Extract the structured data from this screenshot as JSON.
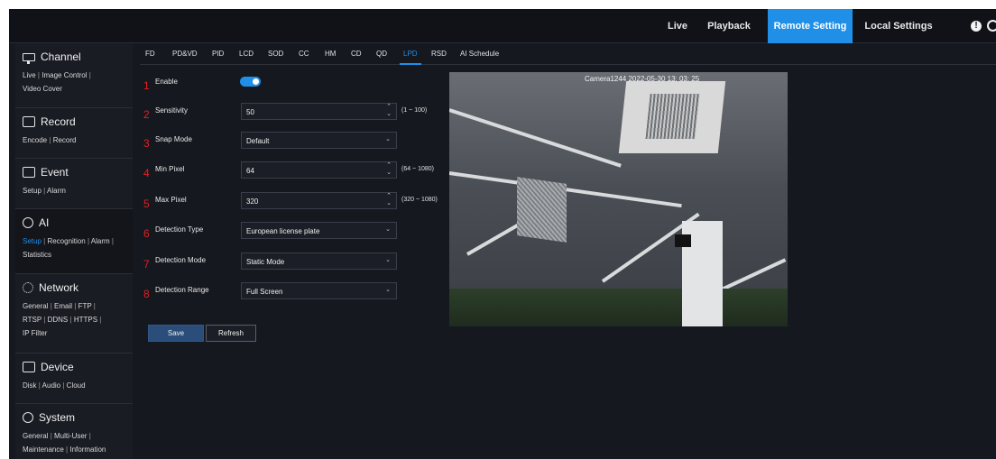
{
  "topnav": {
    "live": "Live",
    "playback": "Playback",
    "remote_setting": "Remote Setting",
    "local_settings": "Local Settings"
  },
  "sidebar": {
    "channel": {
      "title": "Channel",
      "links": [
        "Live",
        "Image Control",
        "Video Cover"
      ]
    },
    "record": {
      "title": "Record",
      "links": [
        "Encode",
        "Record"
      ]
    },
    "event": {
      "title": "Event",
      "links": [
        "Setup",
        "Alarm"
      ]
    },
    "ai": {
      "title": "AI",
      "links": [
        "Setup",
        "Recognition",
        "Alarm",
        "Statistics"
      ]
    },
    "network": {
      "title": "Network",
      "links": [
        "General",
        "Email",
        "FTP",
        "RTSP",
        "DDNS",
        "HTTPS",
        "IP Filter"
      ]
    },
    "device": {
      "title": "Device",
      "links": [
        "Disk",
        "Audio",
        "Cloud"
      ]
    },
    "system": {
      "title": "System",
      "links": [
        "General",
        "Multi-User",
        "Maintenance",
        "Information"
      ]
    }
  },
  "tabs": [
    "FD",
    "PD&VD",
    "PID",
    "LCD",
    "SOD",
    "CC",
    "HM",
    "CD",
    "QD",
    "LPD",
    "RSD",
    "AI Schedule"
  ],
  "active_tab": "LPD",
  "form": {
    "enable": {
      "num": "1",
      "label": "Enable",
      "on": true
    },
    "sensitivity": {
      "num": "2",
      "label": "Sensitivity",
      "value": "50",
      "range": "(1 ~ 100)"
    },
    "snap_mode": {
      "num": "3",
      "label": "Snap Mode",
      "value": "Default"
    },
    "min_pixel": {
      "num": "4",
      "label": "Min Pixel",
      "value": "64",
      "range": "(64 ~ 1080)"
    },
    "max_pixel": {
      "num": "5",
      "label": "Max Pixel",
      "value": "320",
      "range": "(320 ~ 1080)"
    },
    "detection_type": {
      "num": "6",
      "label": "Detection Type",
      "value": "European license plate"
    },
    "detection_mode": {
      "num": "7",
      "label": "Detection Mode",
      "value": "Static Mode"
    },
    "detection_range": {
      "num": "8",
      "label": "Detection Range",
      "value": "Full Screen"
    }
  },
  "buttons": {
    "save": "Save",
    "refresh": "Refresh"
  },
  "preview": {
    "timestamp": "Camera1244  2022-05-30  13: 03: 25"
  },
  "colors": {
    "accent": "#1f8fe8",
    "marker": "#e02020",
    "background": "#16181f"
  },
  "icons": {
    "alert": "exclamation-circle-icon",
    "power": "power-icon",
    "spinner": "up-down-spinner-icon",
    "dropdown": "chevron-down-icon"
  }
}
